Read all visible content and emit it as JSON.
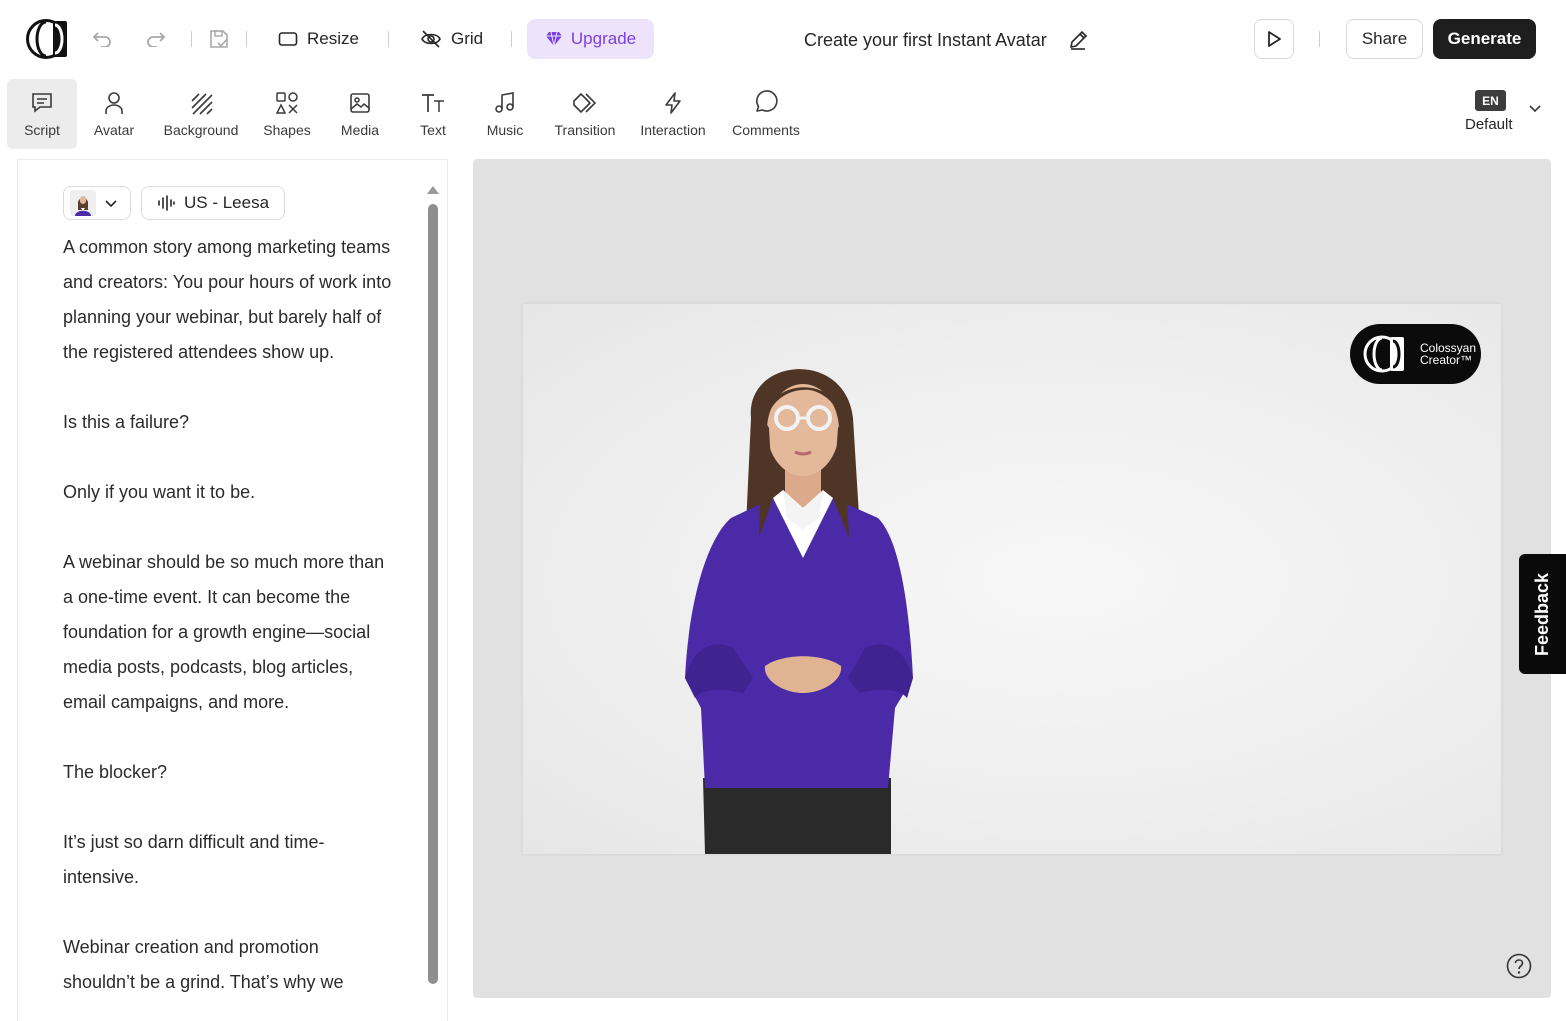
{
  "toolbar": {
    "resize_label": "Resize",
    "grid_label": "Grid",
    "upgrade_label": "Upgrade",
    "project_title": "Create your first Instant Avatar",
    "share_label": "Share",
    "generate_label": "Generate"
  },
  "tools": [
    {
      "label": "Script",
      "icon": "script-icon",
      "active": true
    },
    {
      "label": "Avatar",
      "icon": "avatar-icon"
    },
    {
      "label": "Background",
      "icon": "background-icon"
    },
    {
      "label": "Shapes",
      "icon": "shapes-icon"
    },
    {
      "label": "Media",
      "icon": "media-icon"
    },
    {
      "label": "Text",
      "icon": "text-icon"
    },
    {
      "label": "Music",
      "icon": "music-icon"
    },
    {
      "label": "Transition",
      "icon": "transition-icon"
    },
    {
      "label": "Interaction",
      "icon": "interaction-icon"
    },
    {
      "label": "Comments",
      "icon": "comments-icon"
    }
  ],
  "language": {
    "code": "EN",
    "label": "Default"
  },
  "script": {
    "voice_label": "US - Leesa",
    "paragraphs": [
      "A common story among marketing teams and creators: You pour hours of work into planning your webinar, but barely half of the registered attendees show up.",
      "Is this a failure?",
      "Only if you want it to be.",
      "A webinar should be so much more than a one-time event. It can become the foundation for a growth engine—social media posts, podcasts, blog articles, email campaigns, and more.",
      "The blocker?",
      "It’s just so darn difficult and time-intensive.",
      "Webinar creation and promotion shouldn’t be a grind. That’s why we"
    ]
  },
  "slide": {
    "brand_line1": "Colossyan",
    "brand_line2": "Creator™"
  },
  "feedback_label": "Feedback",
  "colors": {
    "accent": "#7b3fe0",
    "upgrade_bg": "#ede4fb",
    "primary_button": "#1e1e1e",
    "canvas_bg": "#e1e1e1",
    "sweater": "#4a2aa6"
  }
}
